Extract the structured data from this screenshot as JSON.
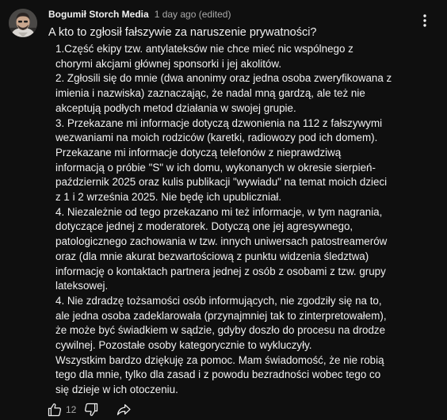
{
  "comment": {
    "author": "Bogumił Storch Media",
    "timestamp": "1 day ago",
    "edited_label": "(edited)",
    "title": "A kto to zgłosił fałszywie za naruszenie prywatności?",
    "lines": [
      "1.Część ekipy tzw. antylateksów nie chce mieć nic wspólnego z",
      "chorymi akcjami głównej sponsorki i jej akolitów.",
      "2. Zgłosili się do mnie (dwa anonimy oraz jedna osoba zweryfikowana z",
      "imienia i nazwiska) zaznaczając, że nadal mną gardzą, ale też nie",
      "akceptują podłych metod działania w swojej grupie.",
      "3. Przekazane mi informacje dotyczą dzwonienia na 112 z fałszywymi",
      "wezwaniami na moich rodziców (karetki, radiowozy pod ich domem).",
      "Przekazane mi informacje dotyczą telefonów z nieprawdziwą",
      "informacją o próbie \"S\" w ich domu, wykonanych w okresie sierpień-",
      "październik 2025 oraz kulis publikacji \"wywiadu\" na temat moich dzieci",
      "z 1 i 2 września 2025.  Nie będę ich upubliczniał.",
      "4. Niezależnie od tego przekazano mi też informacje, w tym nagrania,",
      "dotyczące jednej z moderatorek. Dotyczą one jej agresywnego,",
      "patologicznego zachowania w tzw. innych uniwersach patostreamerów",
      "oraz (dla mnie akurat bezwartościową z punktu widzenia śledztwa)",
      "informację o kontaktach partnera jednej z osób z osobami z tzw. grupy",
      "lateksowej.",
      "4. Nie zdradzę tożsamości osób informujących, nie zgodziły się na to,",
      "ale jedna osoba zadeklarowała (przynajmniej tak to zinterpretowałem),",
      "że może być świadkiem w sądzie, gdyby doszło do procesu na drodze",
      "cywilnej. Pozostałe osoby kategorycznie to wykluczyły.",
      "Wszystkim bardzo dziękuję za pomoc. Mam świadomość, że nie robią",
      "tego dla mnie, tylko dla zasad i z powodu bezradności wobec tego co",
      "się dzieje w ich otoczeniu."
    ],
    "like_count": "12",
    "icons": {
      "avatar": "avatar-photo",
      "menu": "more-vert-icon",
      "like": "thumb-up-icon",
      "dislike": "thumb-down-icon",
      "share": "share-arrow-icon"
    },
    "colors": {
      "background": "#0f0f0f",
      "text_primary": "#f1f1f1",
      "text_secondary": "#aaaaaa"
    }
  }
}
